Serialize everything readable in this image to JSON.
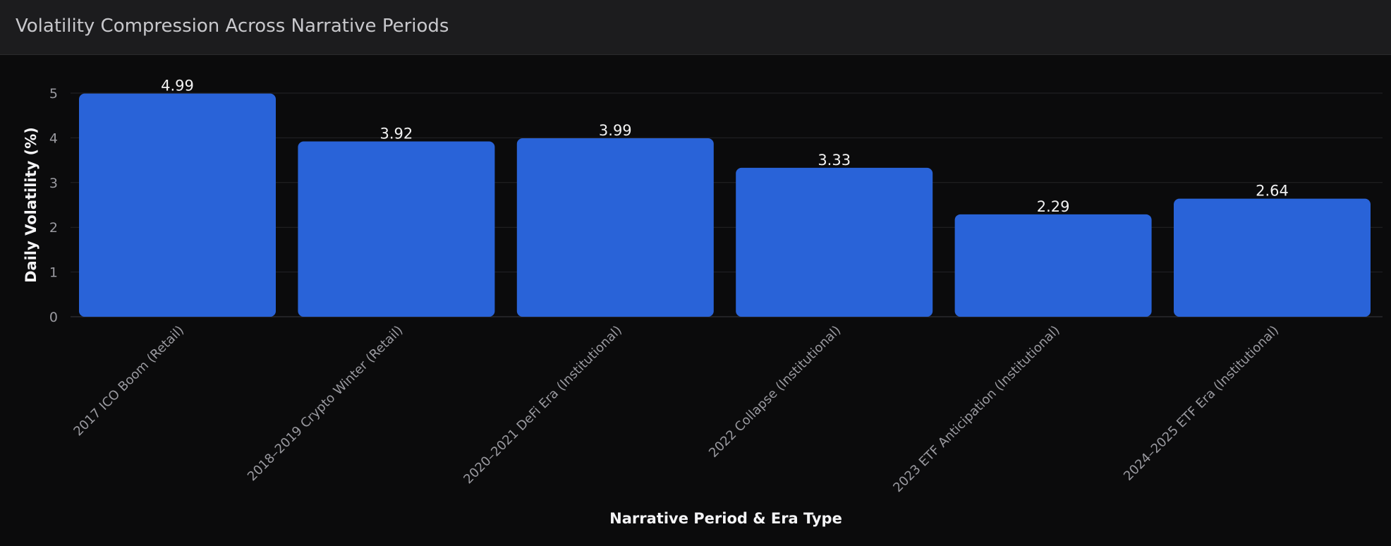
{
  "header": {
    "title": "Volatility Compression Across Narrative Periods"
  },
  "chart_data": {
    "type": "bar",
    "title": "Volatility Compression Across Narrative Periods",
    "xlabel": "Narrative Period & Era Type",
    "ylabel": "Daily Volatility (%)",
    "categories": [
      "2017 ICO Boom (Retail)",
      "2018–2019 Crypto Winter (Retail)",
      "2020–2021 DeFi Era (Institutional)",
      "2022 Collapse (Institutional)",
      "2023 ETF Anticipation (Institutional)",
      "2024–2025 ETF Era (Institutional)"
    ],
    "values": [
      4.99,
      3.92,
      3.99,
      3.33,
      2.29,
      2.64
    ],
    "value_labels": [
      "4.99",
      "3.92",
      "3.99",
      "3.33",
      "2.29",
      "2.64"
    ],
    "yticks": [
      "0",
      "1",
      "2",
      "3",
      "4",
      "5"
    ],
    "ylim": [
      0,
      5
    ],
    "grid": true,
    "bar_color": "#2963d8",
    "background_color": "#0b0b0c"
  }
}
